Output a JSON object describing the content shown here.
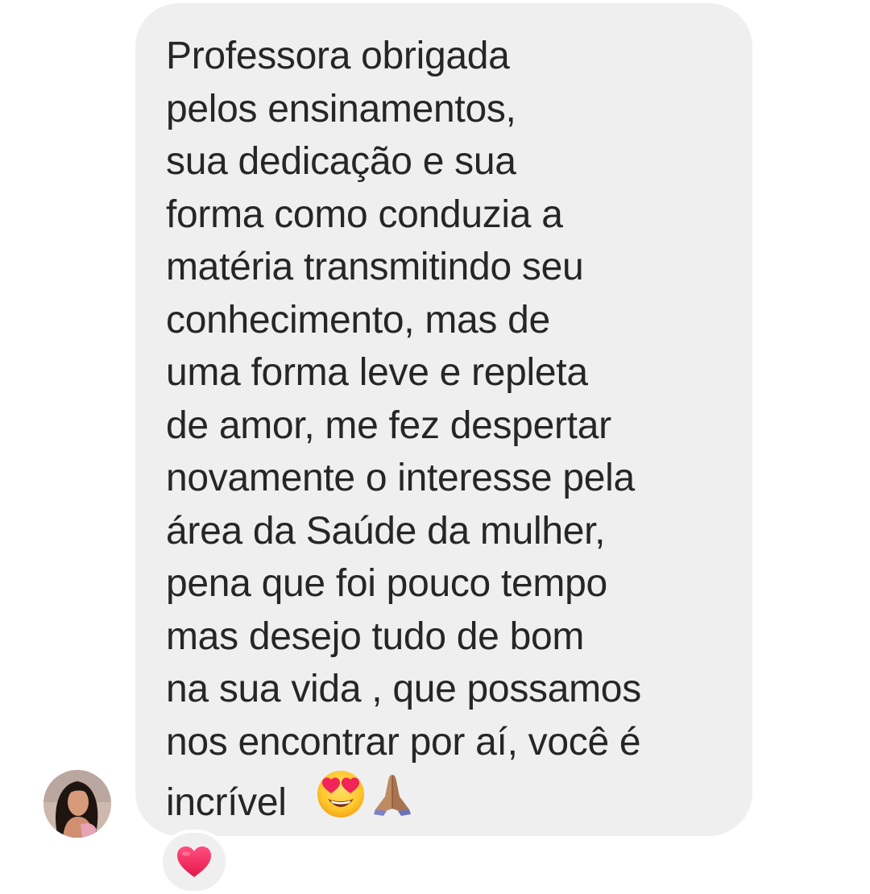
{
  "message": {
    "lines": [
      "Professora obrigada",
      "pelos ensinamentos,",
      "sua dedicação e sua",
      "forma como conduzia a",
      "matéria transmitindo seu",
      "conhecimento, mas de",
      "uma forma leve e repleta",
      "de amor, me fez despertar",
      "novamente o interesse pela",
      "área da Saúde da mulher,",
      "pena que foi pouco tempo",
      "mas desejo tudo de bom",
      "na sua vida , que possamos",
      "nos encontrar por aí, você é",
      "incrível"
    ],
    "emojis": [
      "heart-eyes-emoji",
      "folded-hands-emoji"
    ],
    "colors": {
      "bubble": "#efefef",
      "text": "#262626"
    }
  },
  "reaction": {
    "icon": "heart-icon",
    "color": "#f0245b"
  },
  "sender": {
    "avatar": "sender-avatar"
  }
}
